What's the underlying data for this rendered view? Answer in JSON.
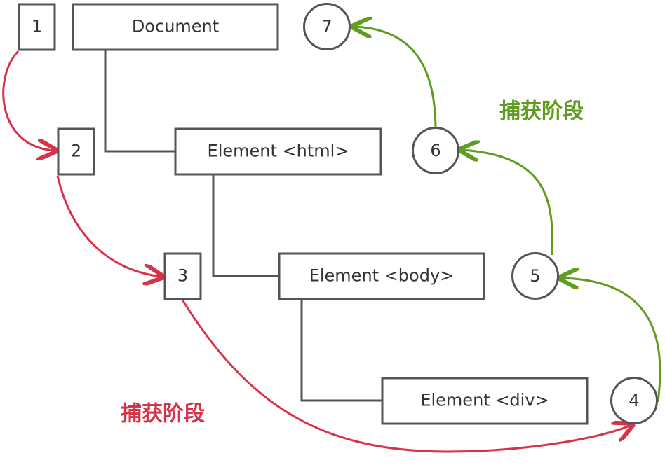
{
  "colors": {
    "box_stroke": "#555555",
    "text": "#333333",
    "capture_arrow": "#d6334a",
    "bubble_arrow": "#5f9c1f"
  },
  "tree": {
    "document": "Document",
    "html": "Element <html>",
    "body": "Element <body>",
    "div": "Element <div>"
  },
  "steps": {
    "s1": "1",
    "s2": "2",
    "s3": "3",
    "s4": "4",
    "s5": "5",
    "s6": "6",
    "s7": "7"
  },
  "labels": {
    "capture_phase_red": "捕获阶段",
    "capture_phase_green": "捕获阶段"
  }
}
